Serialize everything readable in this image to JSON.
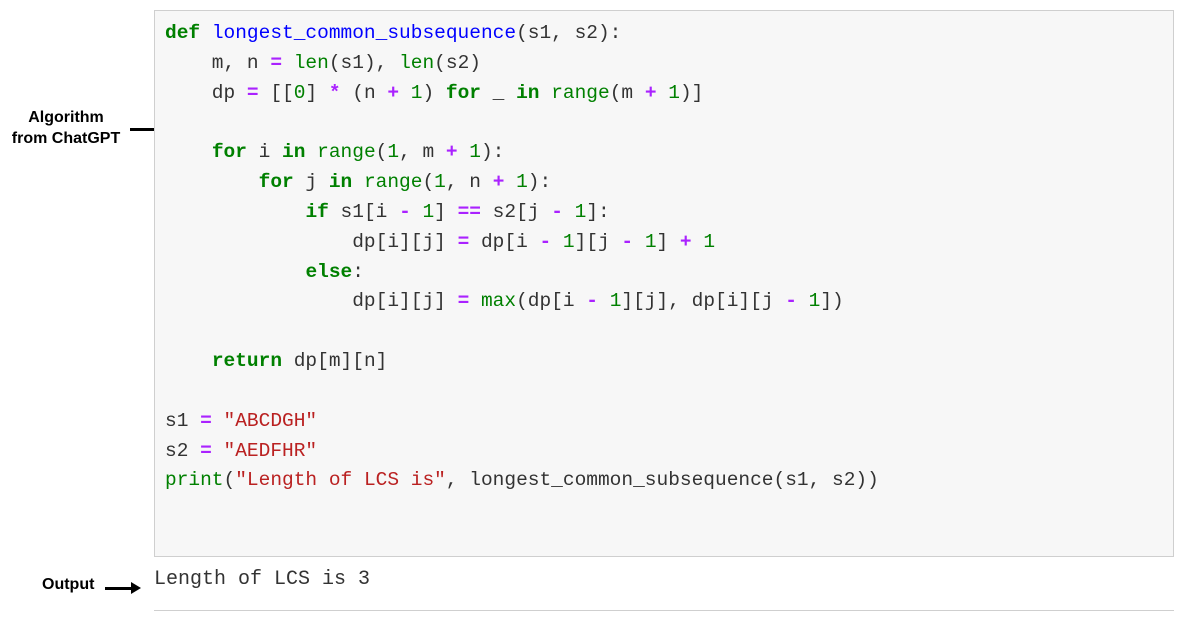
{
  "labels": {
    "algorithm": "Algorithm\nfrom ChatGPT",
    "output": "Output"
  },
  "code": {
    "kw_def": "def",
    "fn_name": "longest_common_subsequence",
    "params": "(s1, s2):",
    "line2_pre": "    m, n ",
    "eq": "=",
    "line2_mid": " ",
    "len1": "len",
    "line2_s1": "(s1), ",
    "len2": "len",
    "line2_s2": "(s2)",
    "line3_pre": "    dp ",
    "line3_mid": " [[",
    "zero": "0",
    "line3_mid2": "] ",
    "star": "*",
    "line3_mid3": " (n ",
    "plus": "+",
    "line3_mid4": " ",
    "one": "1",
    "line3_mid5": ") ",
    "kw_for": "for",
    "line3_mid6": " _ ",
    "kw_in": "in",
    "line3_mid7": " ",
    "range": "range",
    "line3_mid8": "(m ",
    "line3_end": ")]",
    "line5_pre": "    ",
    "line5_mid": " i ",
    "line5_mid2": "(",
    "line5_mid3": ", m ",
    "line5_end": "):",
    "line6_pre": "        ",
    "line6_mid": " j ",
    "line6_mid2": "(",
    "line6_mid3": ", n ",
    "line6_end": "):",
    "line7_pre": "            ",
    "kw_if": "if",
    "line7_mid": " s1[i ",
    "minus": "-",
    "line7_mid2": " ",
    "line7_mid3": "] ",
    "eqeq": "==",
    "line7_mid4": " s2[j ",
    "line7_end": "]:",
    "line8_pre": "                dp[i][j] ",
    "line8_mid": " dp[i ",
    "line8_mid2": "][j ",
    "line8_mid3": "] ",
    "line8_end": "",
    "line9_pre": "            ",
    "kw_else": "else",
    "line9_end": ":",
    "line10_pre": "                dp[i][j] ",
    "line10_mid": " ",
    "max": "max",
    "line10_mid2": "(dp[i ",
    "line10_mid3": "][j], dp[i][j ",
    "line10_end": "])",
    "line12_pre": "    ",
    "kw_return": "return",
    "line12_end": " dp[m][n]",
    "line14_pre": "s1 ",
    "str1": "\"ABCDGH\"",
    "line15_pre": "s2 ",
    "str2": "\"AEDFHR\"",
    "print": "print",
    "line16_mid": "(",
    "str3": "\"Length of LCS is\"",
    "line16_end": ", longest_common_subsequence(s1, s2))"
  },
  "output_text": "Length of LCS is 3"
}
